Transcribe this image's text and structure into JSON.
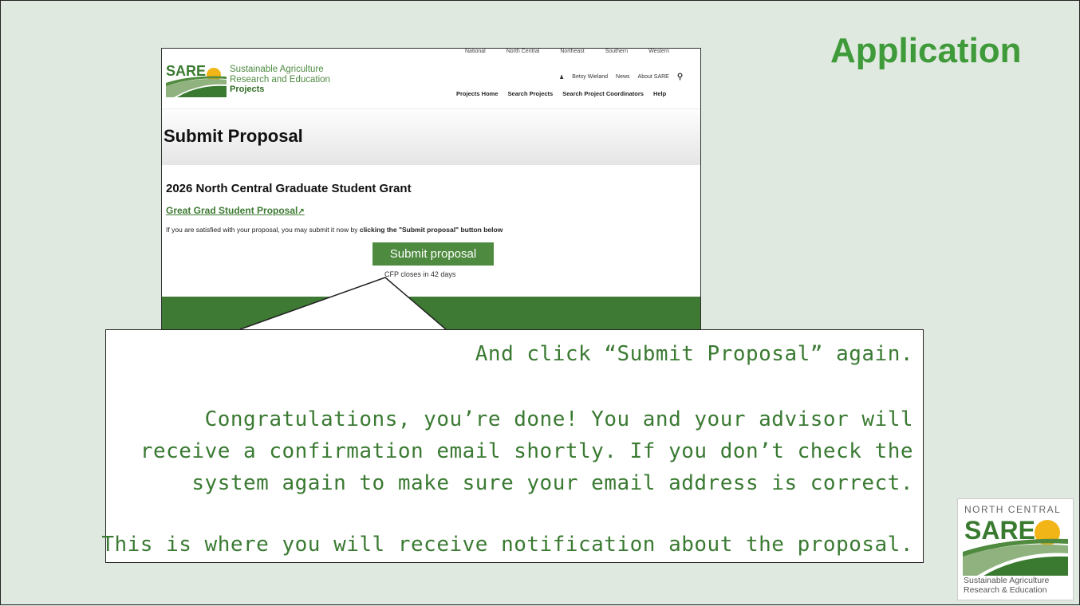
{
  "slide": {
    "title": "Application"
  },
  "screenshot": {
    "region_nav": [
      "National",
      "North Central",
      "Northeast",
      "Southern",
      "Western"
    ],
    "logo_word": "SARE",
    "org_line1": "Sustainable Agriculture",
    "org_line2": "Research and Education",
    "org_line3": "Projects",
    "user_nav": {
      "user": "Betsy Wieland",
      "news": "News",
      "about": "About SARE"
    },
    "main_nav": [
      "Projects Home",
      "Search Projects",
      "Search Project Coordinators",
      "Help"
    ],
    "page_heading": "Submit Proposal",
    "grant_title": "2026 North Central Graduate Student Grant",
    "proposal_link": "Great Grad Student Proposal",
    "info_prefix": "If you are satisfied with your proposal, you may submit it now by ",
    "info_bold": "clicking the \"Submit proposal\" button below",
    "submit_label": "Submit proposal",
    "cfp_text": "CFP closes in 42 days"
  },
  "callout": {
    "line1": "And click “Submit Proposal” again.",
    "line2": "Congratulations, you’re done! You and your advisor will",
    "line3": "receive a confirmation email shortly. If you don’t check the",
    "line4": "system again to make sure your email address is correct.",
    "line5": "This is where you will receive notification about the proposal."
  },
  "corner_logo": {
    "region": "NORTH CENTRAL",
    "word": "SARE",
    "tag1": "Sustainable Agriculture",
    "tag2": "Research & Education"
  },
  "colors": {
    "slide_bg": "#dfe9df",
    "accent_green": "#3f9a3a",
    "button_green": "#4e8a3f",
    "footer_green": "#3e7a34"
  }
}
